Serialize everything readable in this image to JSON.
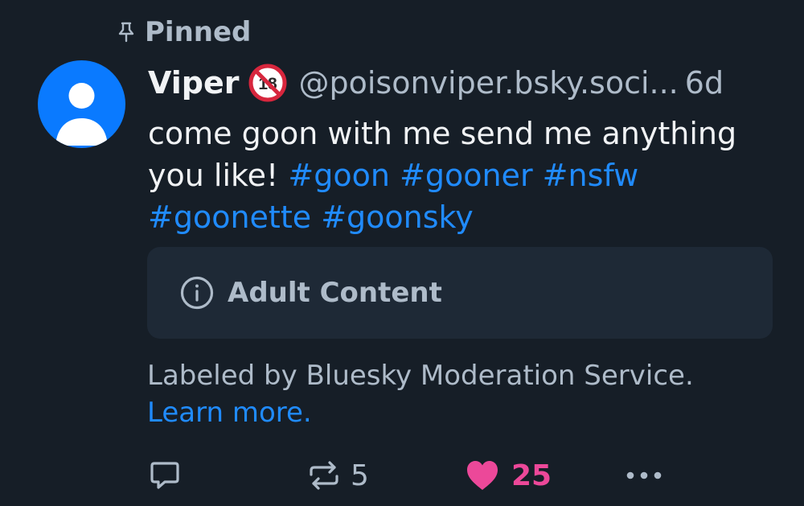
{
  "colors": {
    "background": "#161e27",
    "text_primary": "#f1f3f5",
    "text_secondary": "#aebbc9",
    "link": "#208bfe",
    "like": "#ec4899",
    "avatar": "#0a7aff",
    "card": "#1e2936"
  },
  "pinned": {
    "icon": "pin-icon",
    "label": "Pinned"
  },
  "author": {
    "avatar_icon": "default-user-avatar",
    "display_name": "Viper",
    "badge_icon": "no-under-18-icon",
    "handle": "@poisonviper.bsky.soci...",
    "timestamp": "6d"
  },
  "post": {
    "text": "come goon with me send me anything you like!",
    "hashtags": [
      "#goon",
      "#gooner",
      "#nsfw",
      "#goonette",
      "#goonsky"
    ]
  },
  "content_warning": {
    "icon": "info-circle-icon",
    "label": "Adult Content"
  },
  "moderation": {
    "note": "Labeled by Bluesky Moderation Service.",
    "link": "Learn more."
  },
  "actions": {
    "reply": {
      "icon": "reply-icon"
    },
    "repost": {
      "icon": "repost-icon",
      "count": "5"
    },
    "like": {
      "icon": "heart-filled-icon",
      "count": "25",
      "liked": true
    },
    "more": {
      "icon": "more-horizontal-icon"
    }
  }
}
